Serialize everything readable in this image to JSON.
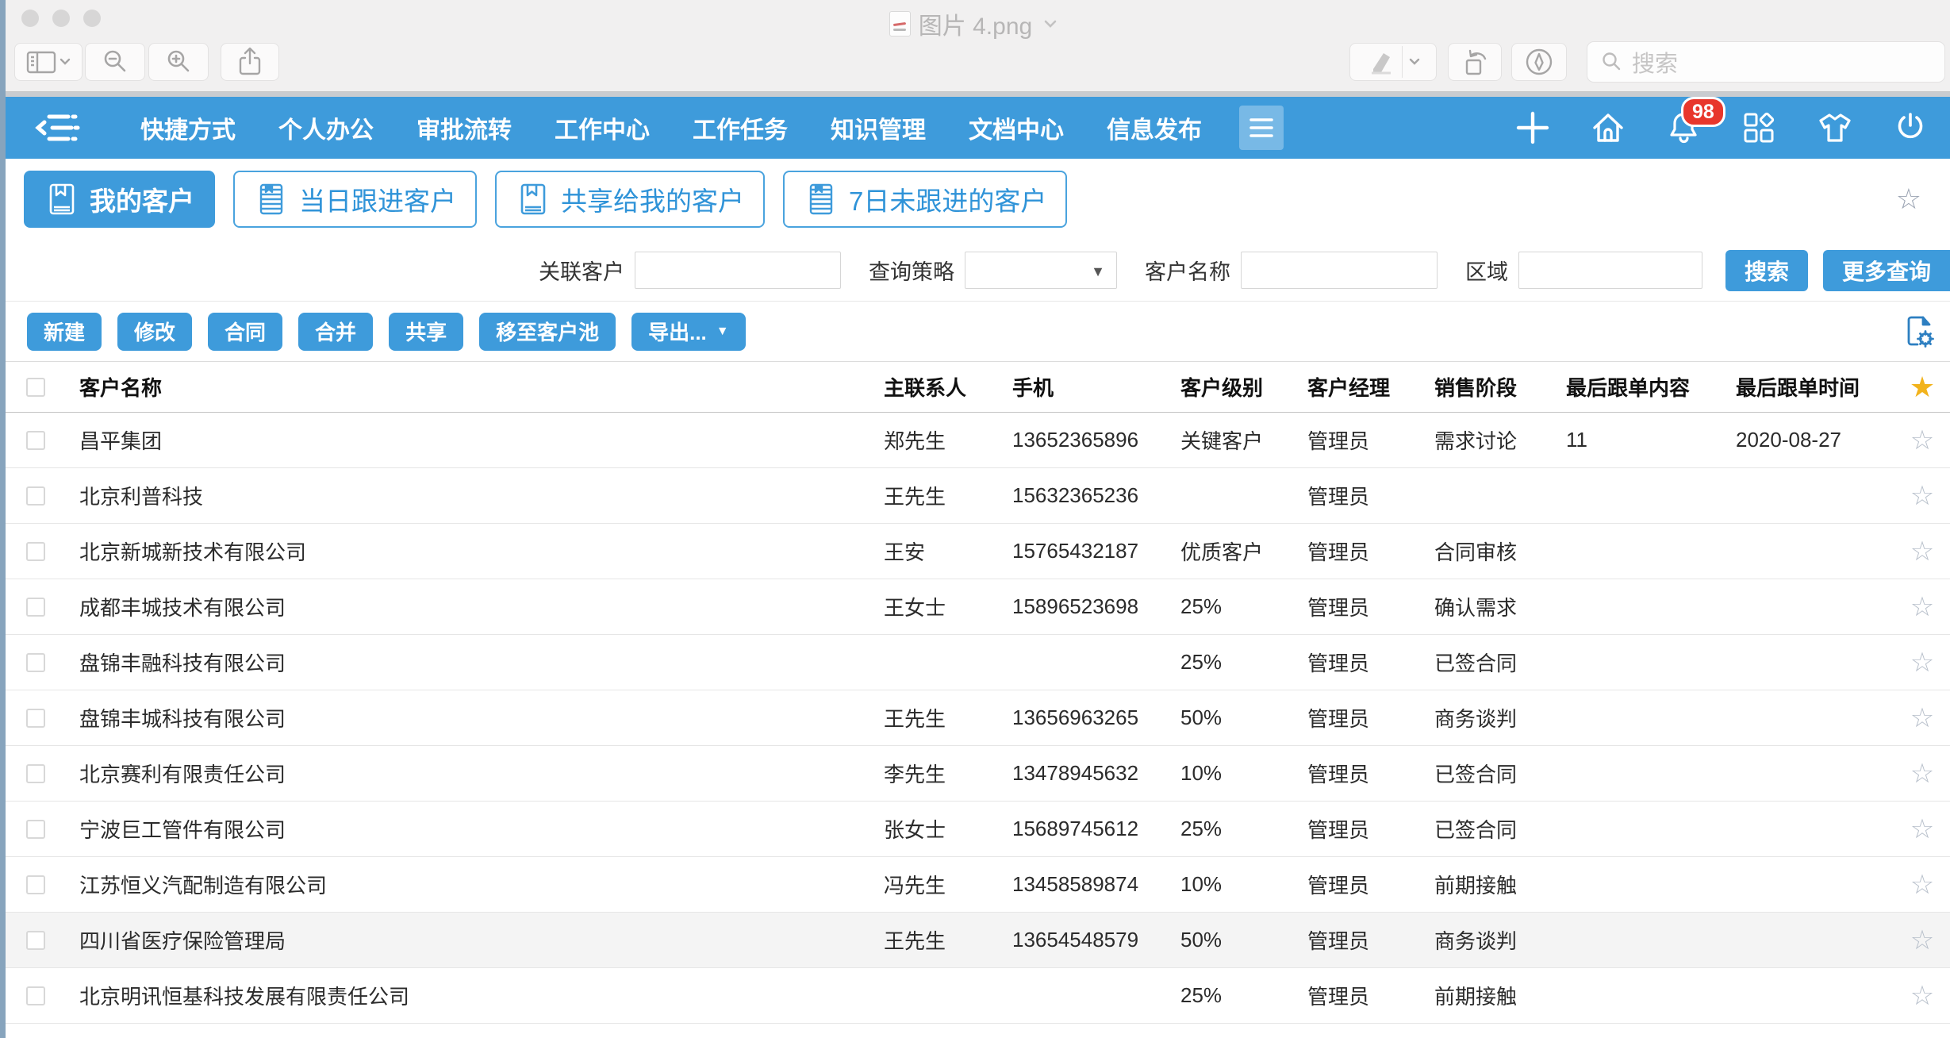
{
  "chrome": {
    "window_title": "图片 4.png",
    "search_placeholder": "搜索"
  },
  "navbar": {
    "items": [
      "快捷方式",
      "个人办公",
      "审批流转",
      "工作中心",
      "工作任务",
      "知识管理",
      "文档中心",
      "信息发布"
    ],
    "notification_count": "98"
  },
  "tabs": [
    {
      "label": "我的客户",
      "active": true,
      "icon": "book-icon"
    },
    {
      "label": "当日跟进客户",
      "active": false,
      "icon": "striped-book-icon"
    },
    {
      "label": "共享给我的客户",
      "active": false,
      "icon": "book-icon"
    },
    {
      "label": "7日未跟进的客户",
      "active": false,
      "icon": "striped-book-icon"
    }
  ],
  "filters": {
    "related_customer_label": "关联客户",
    "query_strategy_label": "查询策略",
    "customer_name_label": "客户名称",
    "region_label": "区域",
    "search_button": "搜索",
    "more_button": "更多查询"
  },
  "actions": [
    {
      "label": "新建",
      "has_dropdown": false
    },
    {
      "label": "修改",
      "has_dropdown": false
    },
    {
      "label": "合同",
      "has_dropdown": false
    },
    {
      "label": "合并",
      "has_dropdown": false
    },
    {
      "label": "共享",
      "has_dropdown": false
    },
    {
      "label": "移至客户池",
      "has_dropdown": false
    },
    {
      "label": "导出...",
      "has_dropdown": true
    }
  ],
  "table": {
    "columns": [
      "客户名称",
      "主联系人",
      "手机",
      "客户级别",
      "客户经理",
      "销售阶段",
      "最后跟单内容",
      "最后跟单时间"
    ],
    "rows": [
      {
        "name": "昌平集团",
        "contact": "郑先生",
        "phone": "13652365896",
        "level": "关键客户",
        "manager": "管理员",
        "stage": "需求讨论",
        "last_content": "11",
        "last_time": "2020-08-27",
        "highlight": false
      },
      {
        "name": "北京利普科技",
        "contact": "王先生",
        "phone": "15632365236",
        "level": "",
        "manager": "管理员",
        "stage": "",
        "last_content": "",
        "last_time": "",
        "highlight": false
      },
      {
        "name": "北京新城新技术有限公司",
        "contact": "王安",
        "phone": "15765432187",
        "level": "优质客户",
        "manager": "管理员",
        "stage": "合同审核",
        "last_content": "",
        "last_time": "",
        "highlight": false
      },
      {
        "name": "成都丰城技术有限公司",
        "contact": "王女士",
        "phone": "15896523698",
        "level": "25%",
        "manager": "管理员",
        "stage": "确认需求",
        "last_content": "",
        "last_time": "",
        "highlight": false
      },
      {
        "name": "盘锦丰融科技有限公司",
        "contact": "",
        "phone": "",
        "level": "25%",
        "manager": "管理员",
        "stage": "已签合同",
        "last_content": "",
        "last_time": "",
        "highlight": false
      },
      {
        "name": "盘锦丰城科技有限公司",
        "contact": "王先生",
        "phone": "13656963265",
        "level": "50%",
        "manager": "管理员",
        "stage": "商务谈判",
        "last_content": "",
        "last_time": "",
        "highlight": false
      },
      {
        "name": "北京赛利有限责任公司",
        "contact": "李先生",
        "phone": "13478945632",
        "level": "10%",
        "manager": "管理员",
        "stage": "已签合同",
        "last_content": "",
        "last_time": "",
        "highlight": false
      },
      {
        "name": "宁波巨工管件有限公司",
        "contact": "张女士",
        "phone": "15689745612",
        "level": "25%",
        "manager": "管理员",
        "stage": "已签合同",
        "last_content": "",
        "last_time": "",
        "highlight": false
      },
      {
        "name": "江苏恒义汽配制造有限公司",
        "contact": "冯先生",
        "phone": "13458589874",
        "level": "10%",
        "manager": "管理员",
        "stage": "前期接触",
        "last_content": "",
        "last_time": "",
        "highlight": false
      },
      {
        "name": "四川省医疗保险管理局",
        "contact": "王先生",
        "phone": "13654548579",
        "level": "50%",
        "manager": "管理员",
        "stage": "商务谈判",
        "last_content": "",
        "last_time": "",
        "highlight": true
      },
      {
        "name": "北京明讯恒基科技发展有限责任公司",
        "contact": "",
        "phone": "",
        "level": "25%",
        "manager": "管理员",
        "stage": "前期接触",
        "last_content": "",
        "last_time": "",
        "highlight": false
      }
    ]
  },
  "icons": {
    "star_filled": "★",
    "star_outline": "☆",
    "caret_down": "▼"
  },
  "colors": {
    "accent_blue": "#3e9bdb",
    "badge_red": "#e8372c",
    "star_gold": "#f2b31c"
  }
}
